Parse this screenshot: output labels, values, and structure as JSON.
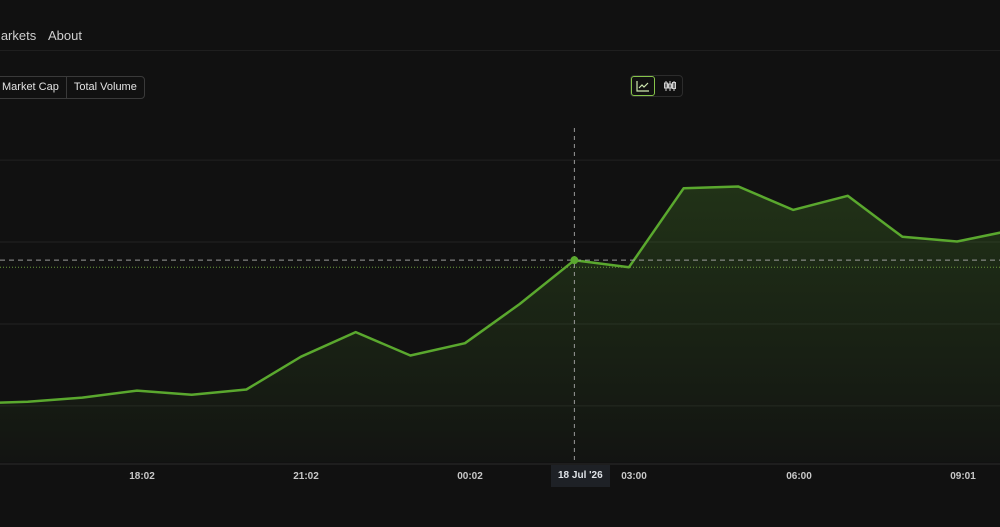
{
  "nav": {
    "markets": "Markets",
    "about": "About"
  },
  "metric_toggle": {
    "market_cap": "Market Cap",
    "total_volume": "Total Volume"
  },
  "view_toggle": {
    "line_icon": "line-chart-icon",
    "candle_icon": "candlestick-icon",
    "active": "line"
  },
  "colors": {
    "accent": "#5aa82e",
    "accent_light": "#86c44a",
    "background": "#111111"
  },
  "crosshair": {
    "label": "18 Jul '26",
    "value_index": 11
  },
  "chart_data": {
    "type": "area",
    "x_tick_labels": [
      "18:02",
      "21:02",
      "00:02",
      "03:00",
      "06:00",
      "09:01"
    ],
    "x": [
      15.0,
      16.0,
      17.0,
      18.0,
      19.0,
      20.0,
      21.0,
      22.0,
      23.0,
      24.0,
      25.0,
      26.0,
      27.0,
      28.0,
      29.0,
      30.0,
      31.0,
      32.0,
      33.0,
      34.0
    ],
    "values": [
      1.0,
      1.03,
      1.1,
      1.22,
      1.15,
      1.24,
      1.8,
      2.22,
      1.82,
      2.03,
      2.7,
      3.45,
      3.33,
      4.68,
      4.71,
      4.31,
      4.55,
      3.85,
      3.77,
      3.96
    ],
    "y_range": [
      0,
      6
    ],
    "grid": true,
    "legend": "none"
  }
}
